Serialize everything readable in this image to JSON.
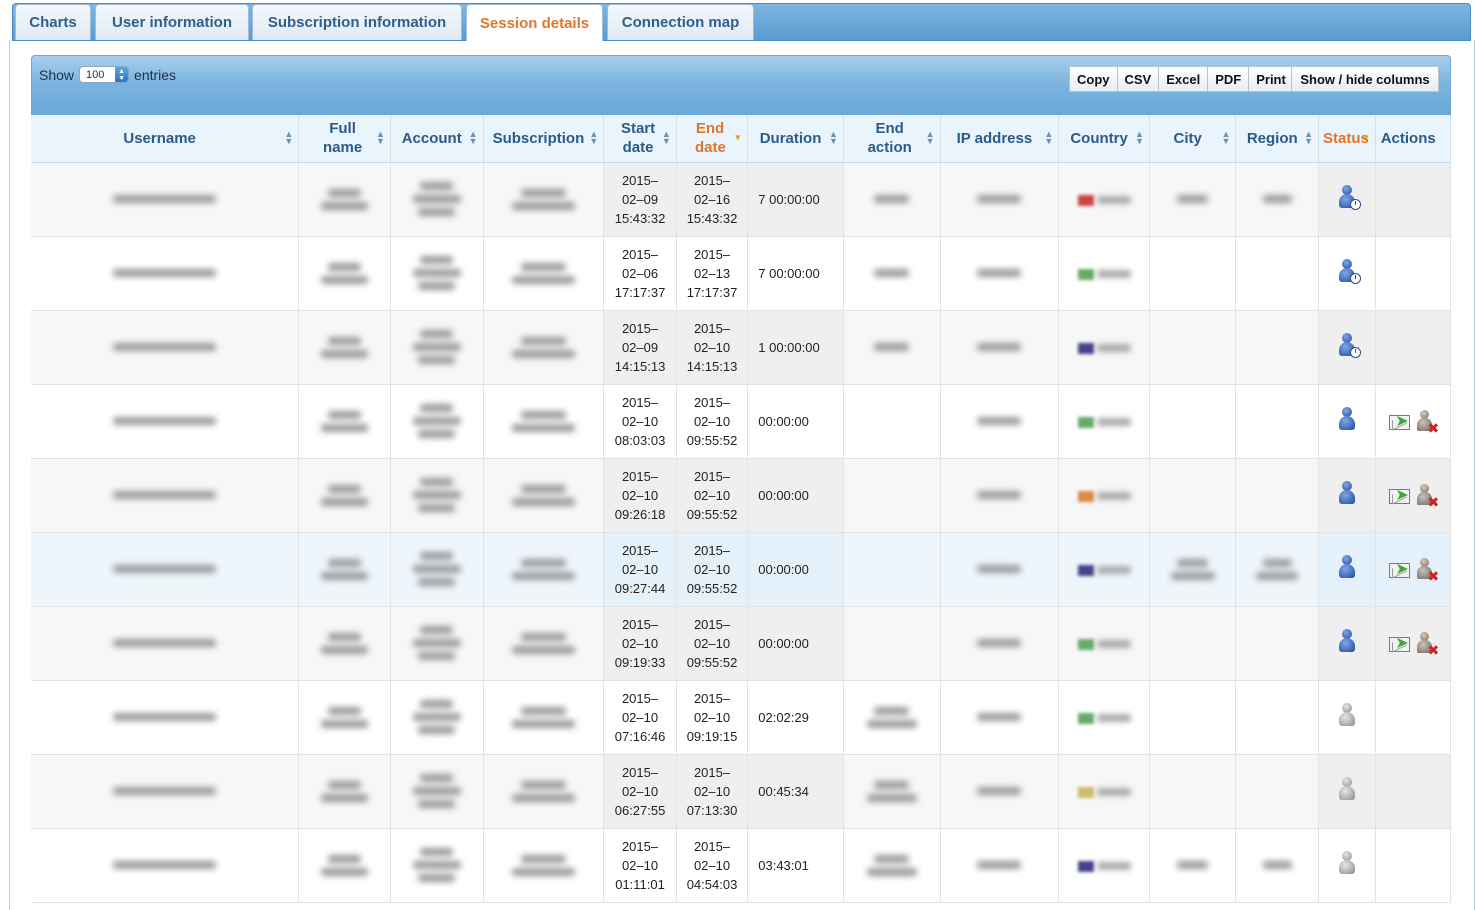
{
  "tabs": [
    {
      "label": "Charts",
      "active": false
    },
    {
      "label": "User information",
      "active": false
    },
    {
      "label": "Subscription information",
      "active": false
    },
    {
      "label": "Session details",
      "active": true
    },
    {
      "label": "Connection map",
      "active": false
    }
  ],
  "toolbar": {
    "show_label": "Show",
    "entries_label": "entries",
    "page_length": "100",
    "export_buttons": [
      "Copy",
      "CSV",
      "Excel",
      "PDF",
      "Print"
    ],
    "columns_button": "Show / hide columns"
  },
  "table": {
    "columns": [
      {
        "label": "Username",
        "sorted": false
      },
      {
        "label": "Full name",
        "sorted": false
      },
      {
        "label": "Account",
        "sorted": false
      },
      {
        "label": "Subscription",
        "sorted": false
      },
      {
        "label": "Start date",
        "sorted": false
      },
      {
        "label": "End date",
        "sorted": true,
        "direction": "desc"
      },
      {
        "label": "Duration",
        "sorted": false
      },
      {
        "label": "End action",
        "sorted": false
      },
      {
        "label": "IP address",
        "sorted": false
      },
      {
        "label": "Country",
        "sorted": false
      },
      {
        "label": "City",
        "sorted": false
      },
      {
        "label": "Region",
        "sorted": false
      },
      {
        "label": "Status",
        "sorted": true,
        "direction": "desc"
      },
      {
        "label": "Actions",
        "sorted": false
      }
    ],
    "rows": [
      {
        "start": [
          "2015–",
          "02–09",
          "15:43:32"
        ],
        "end": [
          "2015–",
          "02–16",
          "15:43:32"
        ],
        "duration": "7 00:00:00",
        "status": "online-idle",
        "actions": false,
        "highlight": false
      },
      {
        "start": [
          "2015–",
          "02–06",
          "17:17:37"
        ],
        "end": [
          "2015–",
          "02–13",
          "17:17:37"
        ],
        "duration": "7 00:00:00",
        "status": "online-idle",
        "actions": false,
        "highlight": false
      },
      {
        "start": [
          "2015–",
          "02–09",
          "14:15:13"
        ],
        "end": [
          "2015–",
          "02–10",
          "14:15:13"
        ],
        "duration": "1 00:00:00",
        "status": "online-idle",
        "actions": false,
        "highlight": false
      },
      {
        "start": [
          "2015–",
          "02–10",
          "08:03:03"
        ],
        "end": [
          "2015–",
          "02–10",
          "09:55:52"
        ],
        "duration": "00:00:00",
        "status": "online",
        "actions": true,
        "highlight": false
      },
      {
        "start": [
          "2015–",
          "02–10",
          "09:26:18"
        ],
        "end": [
          "2015–",
          "02–10",
          "09:55:52"
        ],
        "duration": "00:00:00",
        "status": "online",
        "actions": true,
        "highlight": false
      },
      {
        "start": [
          "2015–",
          "02–10",
          "09:27:44"
        ],
        "end": [
          "2015–",
          "02–10",
          "09:55:52"
        ],
        "duration": "00:00:00",
        "status": "online",
        "actions": true,
        "highlight": true
      },
      {
        "start": [
          "2015–",
          "02–10",
          "09:19:33"
        ],
        "end": [
          "2015–",
          "02–10",
          "09:55:52"
        ],
        "duration": "00:00:00",
        "status": "online",
        "actions": true,
        "highlight": false
      },
      {
        "start": [
          "2015–",
          "02–10",
          "07:16:46"
        ],
        "end": [
          "2015–",
          "02–10",
          "09:19:15"
        ],
        "duration": "02:02:29",
        "status": "offline",
        "actions": false,
        "highlight": false
      },
      {
        "start": [
          "2015–",
          "02–10",
          "06:27:55"
        ],
        "end": [
          "2015–",
          "02–10",
          "07:13:30"
        ],
        "duration": "00:45:34",
        "status": "offline",
        "actions": false,
        "highlight": false
      },
      {
        "start": [
          "2015–",
          "02–10",
          "01:11:01"
        ],
        "end": [
          "2015–",
          "02–10",
          "04:54:03"
        ],
        "duration": "03:43:01",
        "status": "offline",
        "actions": false,
        "highlight": false
      }
    ]
  },
  "colors": {
    "tab_active_text": "#e0762a",
    "tab_text": "#2f5f8c",
    "header_text": "#2b5b89",
    "toolbar_blue": "#7db5e0",
    "status_online": "#1f4a9c",
    "status_offline": "#8a8a8a"
  }
}
